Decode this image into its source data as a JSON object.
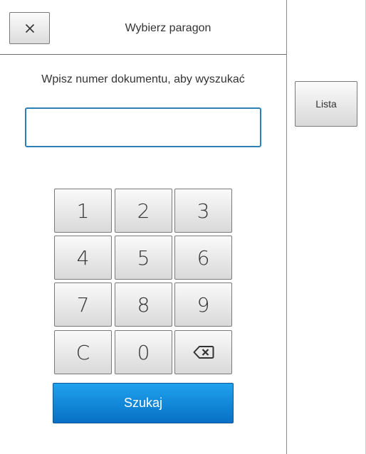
{
  "dialog": {
    "title": "Wybierz paragon",
    "close_icon": "close-icon"
  },
  "search": {
    "prompt": "Wpisz numer dokumentu, aby wyszukać",
    "input_value": "",
    "placeholder": ""
  },
  "keypad": {
    "keys": [
      "1",
      "2",
      "3",
      "4",
      "5",
      "6",
      "7",
      "8",
      "9",
      "C",
      "0"
    ],
    "backspace_icon": "backspace-icon"
  },
  "actions": {
    "search_label": "Szukaj",
    "list_label": "Lista"
  },
  "colors": {
    "accent": "#0a84d6",
    "input_border": "#2f7fb7"
  }
}
